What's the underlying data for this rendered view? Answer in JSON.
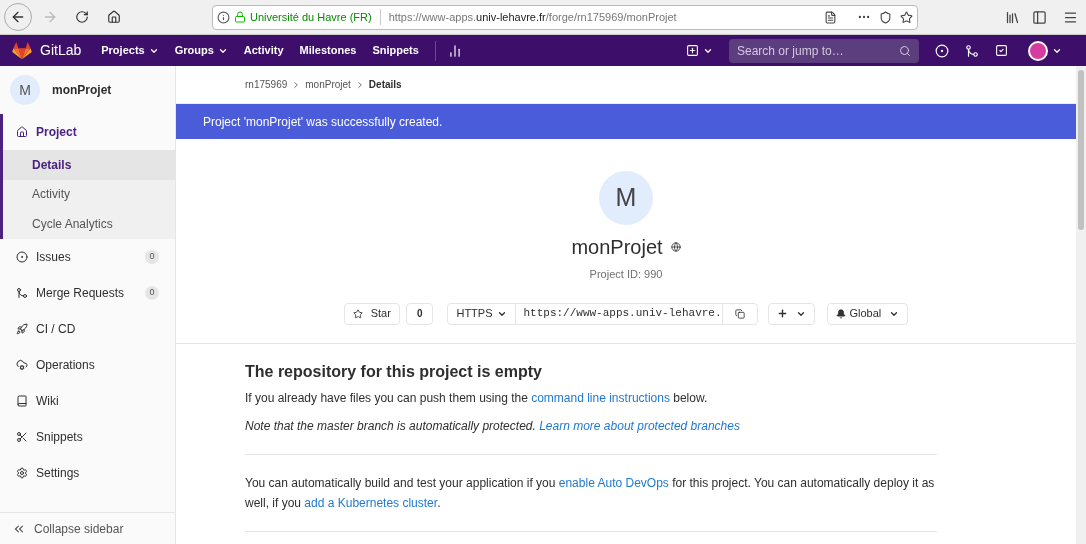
{
  "browser": {
    "back_enabled": true,
    "forward_enabled": false,
    "site_identity": "Université du Havre (FR)",
    "url": {
      "scheme": "https://www-apps.",
      "host": "univ-lehavre.fr",
      "path": "/forge/rn175969/monProjet"
    }
  },
  "navbar": {
    "brand": "GitLab",
    "items": [
      {
        "label": "Projects",
        "dropdown": true
      },
      {
        "label": "Groups",
        "dropdown": true
      },
      {
        "label": "Activity",
        "dropdown": false
      },
      {
        "label": "Milestones",
        "dropdown": false
      },
      {
        "label": "Snippets",
        "dropdown": false
      }
    ],
    "search": {
      "placeholder": "Search or jump to…"
    }
  },
  "sidebar": {
    "project_initial": "M",
    "project_name": "monProjet",
    "items": [
      {
        "label": "Project",
        "expanded": true,
        "children": [
          {
            "label": "Details",
            "selected": true
          },
          {
            "label": "Activity",
            "selected": false
          },
          {
            "label": "Cycle Analytics",
            "selected": false
          }
        ]
      },
      {
        "label": "Issues",
        "count": "0",
        "expanded": false
      },
      {
        "label": "Merge Requests",
        "count": "0",
        "expanded": false
      },
      {
        "label": "CI / CD",
        "expanded": false
      },
      {
        "label": "Operations",
        "expanded": false
      },
      {
        "label": "Wiki",
        "expanded": false
      },
      {
        "label": "Snippets",
        "expanded": false
      },
      {
        "label": "Settings",
        "expanded": false
      }
    ],
    "collapse": "Collapse sidebar"
  },
  "breadcrumbs": [
    "rn175969",
    "monProjet",
    "Details"
  ],
  "flash": "Project 'monProjet' was successfully created.",
  "project": {
    "initial": "M",
    "name": "monProjet",
    "id_text": "Project ID: 990",
    "star_label": "Star",
    "star_count": "0",
    "protocol": "HTTPS",
    "clone_url": "https://www-apps.univ-lehavre.",
    "notification": "Global"
  },
  "empty_repo": {
    "heading": "The repository for this project is empty",
    "paragraphs": [
      {
        "italic": false,
        "parts": [
          {
            "kind": "text",
            "text": "If you already have files you can push them using the "
          },
          {
            "kind": "link",
            "text": "command line instructions"
          },
          {
            "kind": "text",
            "text": " below."
          }
        ]
      },
      {
        "italic": true,
        "parts": [
          {
            "kind": "text",
            "text": "Note that the master branch is automatically protected. "
          },
          {
            "kind": "link",
            "text": "Learn more about protected branches"
          }
        ]
      }
    ],
    "devops": {
      "italic": false,
      "parts": [
        {
          "kind": "text",
          "text": "You can automatically build and test your application if you "
        },
        {
          "kind": "link",
          "text": "enable Auto DevOps"
        },
        {
          "kind": "text",
          "text": " for this project. You can automatically deploy it as well, if you "
        },
        {
          "kind": "link",
          "text": "add a Kubernetes cluster"
        },
        {
          "kind": "text",
          "text": "."
        }
      ]
    }
  }
}
